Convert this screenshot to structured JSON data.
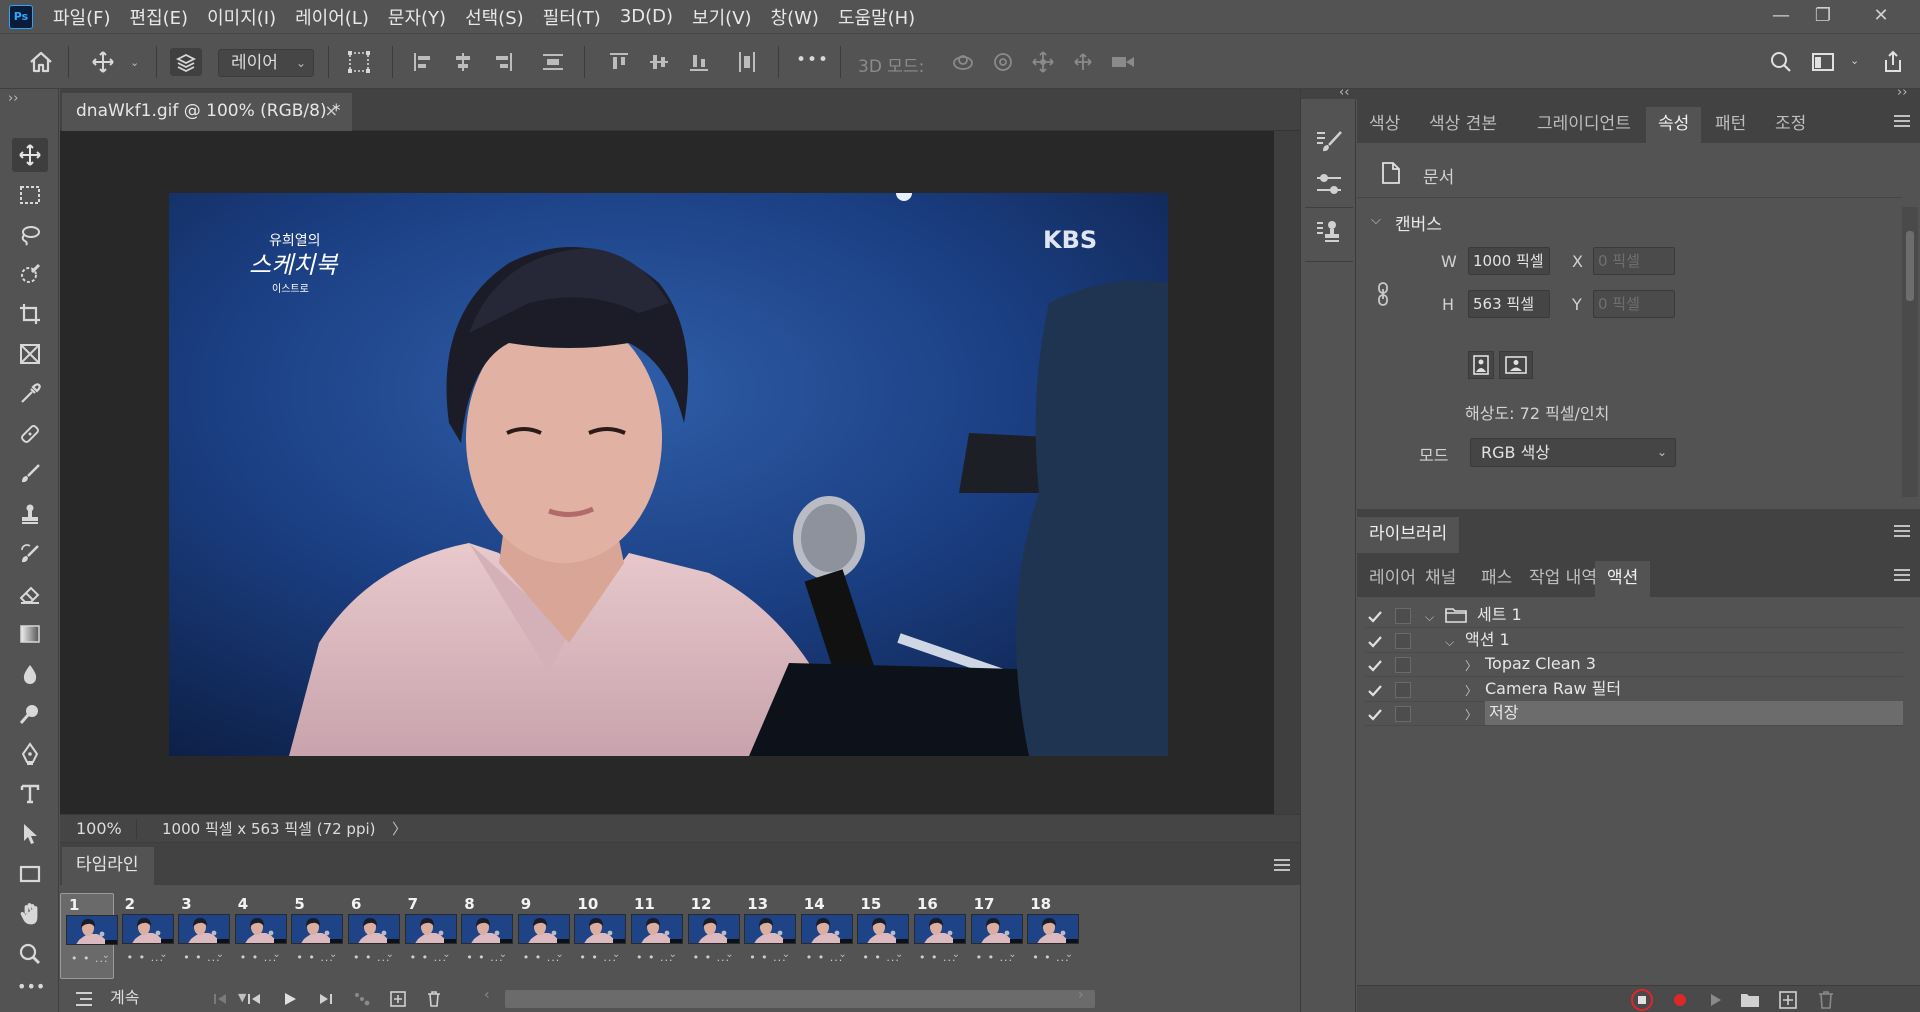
{
  "app": {
    "logo": "Ps"
  },
  "menu": [
    "파일(F)",
    "편집(E)",
    "이미지(I)",
    "레이어(L)",
    "문자(Y)",
    "선택(S)",
    "필터(T)",
    "3D(D)",
    "보기(V)",
    "창(W)",
    "도움말(H)"
  ],
  "window_controls": {
    "minimize": "—",
    "restore": "❐",
    "close": "✕"
  },
  "options": {
    "layer_select": "레이어",
    "mode_3d": "3D 모드:",
    "more": "•••"
  },
  "document": {
    "tab_title": "dnaWkf1.gif @ 100% (RGB/8) *",
    "tab_close": "×",
    "zoom": "100%",
    "info": "1000 픽셀 x 563 픽셀 (72 ppi)",
    "info_arrow": "〉",
    "image": {
      "watermark_line1": "유희열의",
      "watermark_line2": "스케치북",
      "watermark_line3": "이스트로",
      "broadcaster": "KBS"
    }
  },
  "timeline": {
    "tab": "타임라인",
    "frames": [
      "1",
      "2",
      "3",
      "4",
      "5",
      "6",
      "7",
      "8",
      "9",
      "10",
      "11",
      "12",
      "13",
      "14",
      "15",
      "16",
      "17",
      "18"
    ],
    "frame_delay": "• • ...",
    "loop": "계속"
  },
  "properties_tabs": [
    "색상",
    "색상 견본",
    "그레이디언트",
    "속성",
    "패턴",
    "조정"
  ],
  "properties_active": "속성",
  "properties": {
    "doc_label": "문서",
    "section": "캔버스",
    "w_label": "W",
    "w_value": "1000 픽셀",
    "h_label": "H",
    "h_value": "563 픽셀",
    "x_label": "X",
    "x_placeholder": "0 픽셀",
    "y_label": "Y",
    "y_placeholder": "0 픽셀",
    "resolution": "해상도: 72 픽셀/인치",
    "mode_label": "모드",
    "mode_value": "RGB 색상"
  },
  "library": {
    "tab": "라이브러리"
  },
  "lower_tabs": [
    "레이어",
    "채널",
    "패스",
    "작업 내역",
    "액션"
  ],
  "lower_active": "액션",
  "actions": [
    {
      "label": "세트 1",
      "level": 0,
      "expanded": true,
      "folder": true
    },
    {
      "label": "액션 1",
      "level": 1,
      "expanded": true,
      "folder": false
    },
    {
      "label": "Topaz Clean 3",
      "level": 2,
      "expanded": false,
      "folder": false
    },
    {
      "label": "Camera Raw 필터",
      "level": 2,
      "expanded": false,
      "folder": false
    },
    {
      "label": "저장",
      "level": 2,
      "expanded": false,
      "folder": false,
      "selected": true
    }
  ],
  "colors": {
    "bg": "#535353",
    "record": "#e0262b",
    "accent": "#31a8ff"
  }
}
